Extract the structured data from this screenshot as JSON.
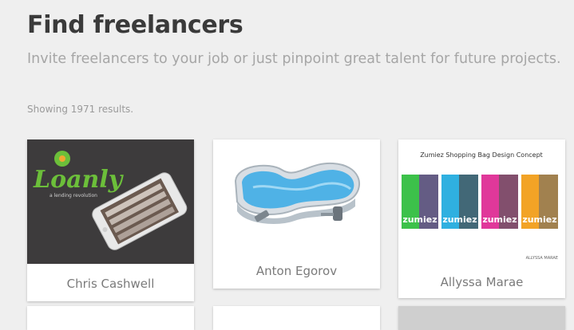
{
  "header": {
    "title": "Find freelancers",
    "subtitle": "Invite freelancers to your job or just pinpoint great talent for future projects."
  },
  "results": {
    "count_text": "Showing 1971 results."
  },
  "freelancers": [
    {
      "name": "Chris Cashwell",
      "thumb_logo": "Loanly",
      "thumb_tagline": "a lending revolution"
    },
    {
      "name": "Anton Egorov"
    },
    {
      "name": "Allyssa Marae",
      "thumb_title": "Zumiez Shopping Bag Design Concept",
      "thumb_brand": "zumiez",
      "thumb_signature": "ALLYSSA MARAE"
    }
  ],
  "colors": {
    "background": "#efefef",
    "title": "#3a3a3a",
    "subtitle": "#a6a6a6",
    "card_name": "#7a7a7a",
    "loanly_green": "#6cbf3a"
  }
}
